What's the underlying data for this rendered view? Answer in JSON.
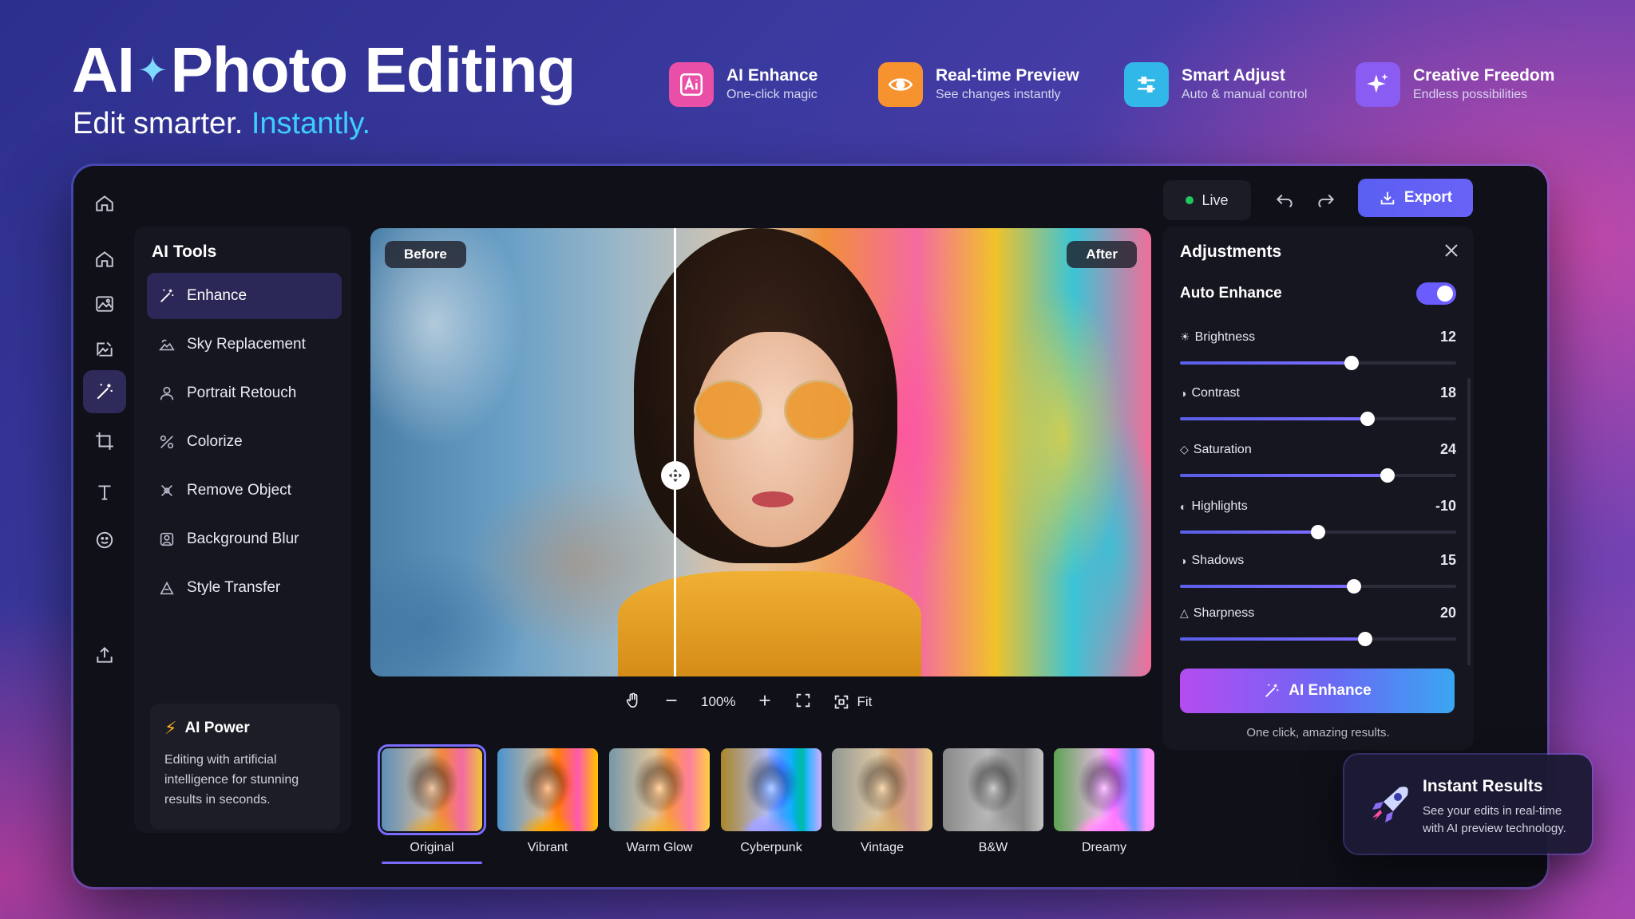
{
  "hero": {
    "title_left": "AI",
    "title_right": "Photo Editing",
    "subtitle_plain": "Edit smarter.",
    "subtitle_accent": "Instantly."
  },
  "features": [
    {
      "title": "AI Enhance",
      "sub": "One-click magic",
      "icon": "ai-text-icon",
      "color": "#e94fa6"
    },
    {
      "title": "Real-time Preview",
      "sub": "See changes instantly",
      "icon": "eye-icon",
      "color": "#f7932e"
    },
    {
      "title": "Smart Adjust",
      "sub": "Auto & manual control",
      "icon": "sliders-icon",
      "color": "#31b8e8"
    },
    {
      "title": "Creative Freedom",
      "sub": "Endless possibilities",
      "icon": "sparkle-icon",
      "color": "#8a5cf2"
    }
  ],
  "topbar": {
    "live_label": "Live",
    "export_label": "Export"
  },
  "tools": {
    "title": "AI Tools",
    "items": [
      {
        "label": "Enhance",
        "icon": "magic-wand-icon",
        "active": true
      },
      {
        "label": "Sky Replacement",
        "icon": "cloud-icon"
      },
      {
        "label": "Portrait Retouch",
        "icon": "person-icon"
      },
      {
        "label": "Colorize",
        "icon": "palette-icon"
      },
      {
        "label": "Remove Object",
        "icon": "eraser-icon"
      },
      {
        "label": "Background Blur",
        "icon": "blur-icon"
      },
      {
        "label": "Style Transfer",
        "icon": "brush-icon"
      }
    ],
    "ai_power": {
      "title": "AI Power",
      "body": "Editing with artificial intelligence for stunning results in seconds."
    }
  },
  "canvas": {
    "before_label": "Before",
    "after_label": "After"
  },
  "zoom": {
    "level": "100%",
    "fit_label": "Fit"
  },
  "presets": [
    {
      "label": "Original",
      "selected": true
    },
    {
      "label": "Vibrant"
    },
    {
      "label": "Warm Glow"
    },
    {
      "label": "Cyberpunk"
    },
    {
      "label": "Vintage"
    },
    {
      "label": "B&W"
    },
    {
      "label": "Dreamy"
    }
  ],
  "adjustments": {
    "title": "Adjustments",
    "auto_enhance_label": "Auto Enhance",
    "auto_enhance_on": true,
    "sliders": [
      {
        "label": "Brightness",
        "value": "12",
        "level": 0.62,
        "icon": "sun-icon"
      },
      {
        "label": "Contrast",
        "value": "18",
        "level": 0.68,
        "icon": "contrast-icon"
      },
      {
        "label": "Saturation",
        "value": "24",
        "level": 0.75,
        "icon": "drop-icon"
      },
      {
        "label": "Highlights",
        "value": "-10",
        "level": 0.5,
        "icon": "highlight-icon"
      },
      {
        "label": "Shadows",
        "value": "15",
        "level": 0.63,
        "icon": "shadow-icon"
      },
      {
        "label": "Sharpness",
        "value": "20",
        "level": 0.67,
        "icon": "triangle-icon"
      }
    ],
    "ai_enhance_button": "AI Enhance",
    "ai_enhance_note": "One click, amazing results."
  },
  "instant_card": {
    "title": "Instant Results",
    "body": "See your edits in real-time with AI preview technology."
  }
}
